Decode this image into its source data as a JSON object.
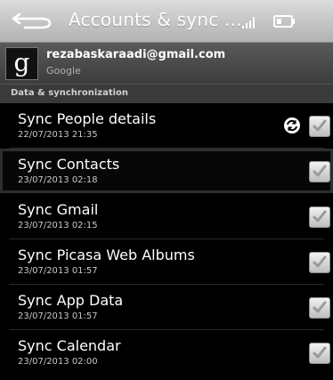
{
  "titlebar": {
    "title": "Accounts & sync ..."
  },
  "account": {
    "email": "rezabaskaraadi@gmail.com",
    "provider": "Google",
    "logo_letter": "g"
  },
  "section": {
    "label": "Data & synchronization"
  },
  "rows": [
    {
      "title": "Sync People details",
      "date": "22/07/2013 21:35",
      "checked": true,
      "syncing": true
    },
    {
      "title": "Sync Contacts",
      "date": "23/07/2013 02:18",
      "checked": true,
      "selected": true
    },
    {
      "title": "Sync Gmail",
      "date": "23/07/2013 02:15",
      "checked": true
    },
    {
      "title": "Sync Picasa Web Albums",
      "date": "23/07/2013 01:57",
      "checked": true
    },
    {
      "title": "Sync App Data",
      "date": "23/07/2013 01:57",
      "checked": true
    },
    {
      "title": "Sync Calendar",
      "date": "23/07/2013 02:00",
      "checked": true
    }
  ],
  "icons": {
    "back": "back-arrow-icon",
    "signal": "signal-icon",
    "battery": "battery-icon",
    "sync": "sync-icon",
    "check": "checkmark-icon"
  }
}
